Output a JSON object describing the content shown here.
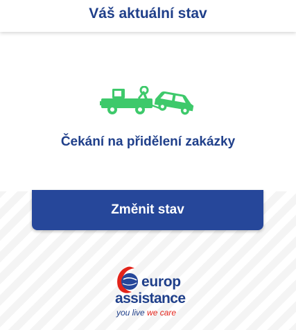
{
  "header": {
    "title": "Váš aktuální stav"
  },
  "status": {
    "icon": "tow-truck-icon",
    "text": "Čekání na přidělení zakázky"
  },
  "actions": {
    "change_label": "Změnit stav"
  },
  "brand": {
    "name_line1": "europ",
    "name_line2": "assistance",
    "tagline_part1": "you live",
    "tagline_part2": "we care"
  },
  "colors": {
    "primary_blue": "#1f3f8a",
    "button_blue": "#26479a",
    "icon_green": "#3ec96b",
    "brand_red": "#e2231a"
  }
}
